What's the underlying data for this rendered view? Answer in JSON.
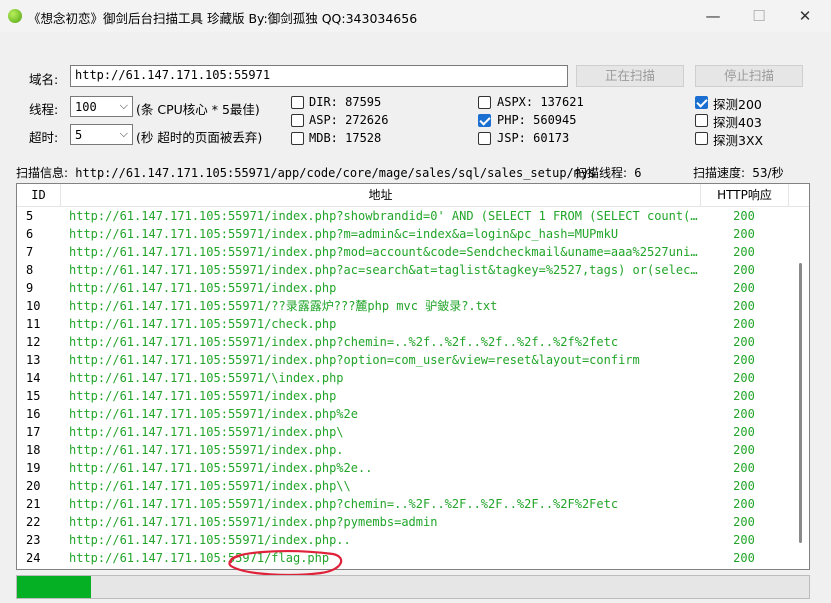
{
  "window": {
    "title": "《想念初恋》御剑后台扫描工具 珍藏版 By:御剑孤独 QQ:343034656",
    "minimize": "—",
    "maximize": "☐",
    "close": "✕"
  },
  "domain": {
    "label": "域名:",
    "value": "http://61.147.171.105:55971"
  },
  "buttons": {
    "start": "正在扫描",
    "stop": "停止扫描"
  },
  "threads": {
    "label": "线程:",
    "value": "100",
    "hint": "(条 CPU核心 * 5最佳)"
  },
  "timeout": {
    "label": "超时:",
    "value": "5",
    "hint": "(秒 超时的页面被丢弃)"
  },
  "dicts": [
    {
      "label": "DIR: 87595",
      "checked": false
    },
    {
      "label": "ASP: 272626",
      "checked": false
    },
    {
      "label": "MDB: 17528",
      "checked": false
    },
    {
      "label": "ASPX: 137621",
      "checked": false
    },
    {
      "label": "PHP: 560945",
      "checked": true
    },
    {
      "label": "JSP: 60173",
      "checked": false
    }
  ],
  "probes": [
    {
      "label": "探测200",
      "checked": true
    },
    {
      "label": "探测403",
      "checked": false
    },
    {
      "label": "探测3XX",
      "checked": false
    }
  ],
  "scan_info": {
    "label": "扫描信息:",
    "path": "http://61.147.171.105:55971/app/code/core/mage/sales/sql/sales_setup/mys",
    "threads_label": "扫描线程:",
    "threads_value": "6",
    "speed_label": "扫描速度:",
    "speed_value": "53/秒"
  },
  "table": {
    "headers": {
      "id": "ID",
      "url": "地址",
      "code": "HTTP响应"
    },
    "rows": [
      {
        "id": "5",
        "url": "http://61.147.171.105:55971/index.php?showbrandid=0' AND (SELECT 1 FROM (SELECT count(* ...",
        "code": "200"
      },
      {
        "id": "6",
        "url": "http://61.147.171.105:55971/index.php?m=admin&c=index&a=login&pc_hash=MUPmkU",
        "code": "200"
      },
      {
        "id": "7",
        "url": "http://61.147.171.105:55971/index.php?mod=account&code=Sendcheckmail&uname=aaa%2527unionse...",
        "code": "200"
      },
      {
        "id": "8",
        "url": "http://61.147.171.105:55971/index.php?ac=search&at=taglist&tagkey=%2527,tags) or(select 1 ...",
        "code": "200"
      },
      {
        "id": "9",
        "url": "http://61.147.171.105:55971/index.php",
        "code": "200"
      },
      {
        "id": "10",
        "url": "http://61.147.171.105:55971/??录露露炉???麓php mvc 驴鈹录?.txt",
        "code": "200"
      },
      {
        "id": "11",
        "url": "http://61.147.171.105:55971/check.php",
        "code": "200"
      },
      {
        "id": "12",
        "url": "http://61.147.171.105:55971/index.php?chemin=..%2f..%2f..%2f..%2f..%2f%2fetc",
        "code": "200"
      },
      {
        "id": "13",
        "url": "http://61.147.171.105:55971/index.php?option=com_user&view=reset&layout=confirm",
        "code": "200"
      },
      {
        "id": "14",
        "url": "http://61.147.171.105:55971/\\index.php",
        "code": "200"
      },
      {
        "id": "15",
        "url": "http://61.147.171.105:55971/index.php",
        "code": "200"
      },
      {
        "id": "16",
        "url": "http://61.147.171.105:55971/index.php%2e",
        "code": "200"
      },
      {
        "id": "17",
        "url": "http://61.147.171.105:55971/index.php\\",
        "code": "200"
      },
      {
        "id": "18",
        "url": "http://61.147.171.105:55971/index.php.",
        "code": "200"
      },
      {
        "id": "19",
        "url": "http://61.147.171.105:55971/index.php%2e..",
        "code": "200"
      },
      {
        "id": "20",
        "url": "http://61.147.171.105:55971/index.php\\\\",
        "code": "200"
      },
      {
        "id": "21",
        "url": "http://61.147.171.105:55971/index.php?chemin=..%2F..%2F..%2F..%2F..%2F%2Fetc",
        "code": "200"
      },
      {
        "id": "22",
        "url": "http://61.147.171.105:55971/index.php?pymembs=admin",
        "code": "200"
      },
      {
        "id": "23",
        "url": "http://61.147.171.105:55971/index.php..",
        "code": "200"
      },
      {
        "id": "24",
        "url": "http://61.147.171.105:55971/flag.php",
        "code": "200"
      }
    ]
  },
  "progress": {
    "fraction": 0.093
  },
  "colors": {
    "url_text": "#22a52a",
    "progress": "#06b025",
    "checkbox_on": "#1a6fd0",
    "annotation": "#e0213a"
  }
}
